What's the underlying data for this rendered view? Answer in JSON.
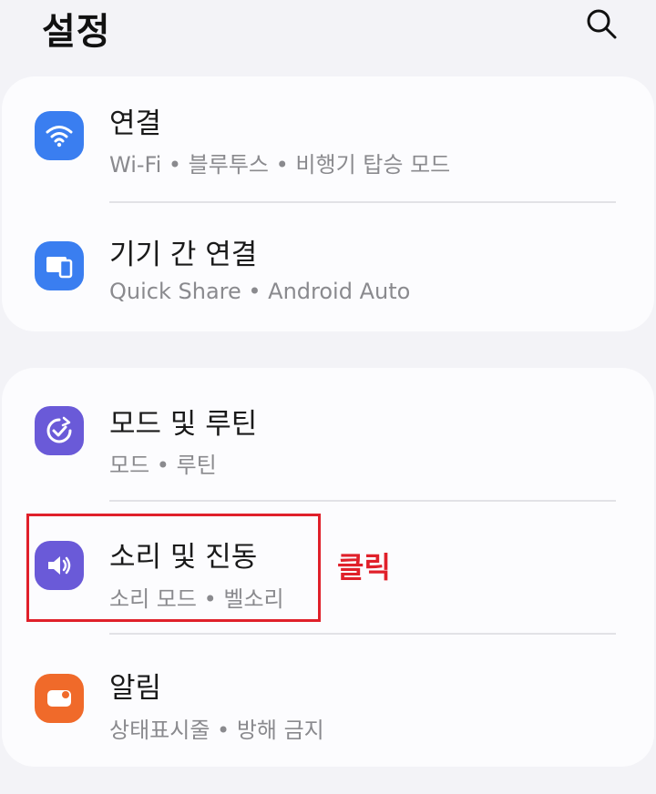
{
  "header": {
    "title": "설정",
    "search_icon": "search-icon"
  },
  "groups": [
    {
      "items": [
        {
          "label": "연결",
          "sub": "Wi-Fi  •  블루투스  •  비행기 탑승 모드",
          "icon": "wifi-icon",
          "color": "#3a7ef0"
        },
        {
          "label": "기기 간 연결",
          "sub": "Quick Share  •  Android Auto",
          "icon": "devices-icon",
          "color": "#3a7ef0"
        }
      ]
    },
    {
      "items": [
        {
          "label": "모드 및 루틴",
          "sub": "모드  •  루틴",
          "icon": "routine-check-icon",
          "color": "#6a5ad8"
        },
        {
          "label": "소리 및 진동",
          "sub": "소리 모드  •  벨소리",
          "icon": "speaker-icon",
          "color": "#6a5ad8"
        },
        {
          "label": "알림",
          "sub": "상태표시줄  •  방해 금지",
          "icon": "notification-icon",
          "color": "#f06a2a"
        }
      ]
    }
  ],
  "annotation": {
    "text": "클릭",
    "color": "#e0202a"
  }
}
